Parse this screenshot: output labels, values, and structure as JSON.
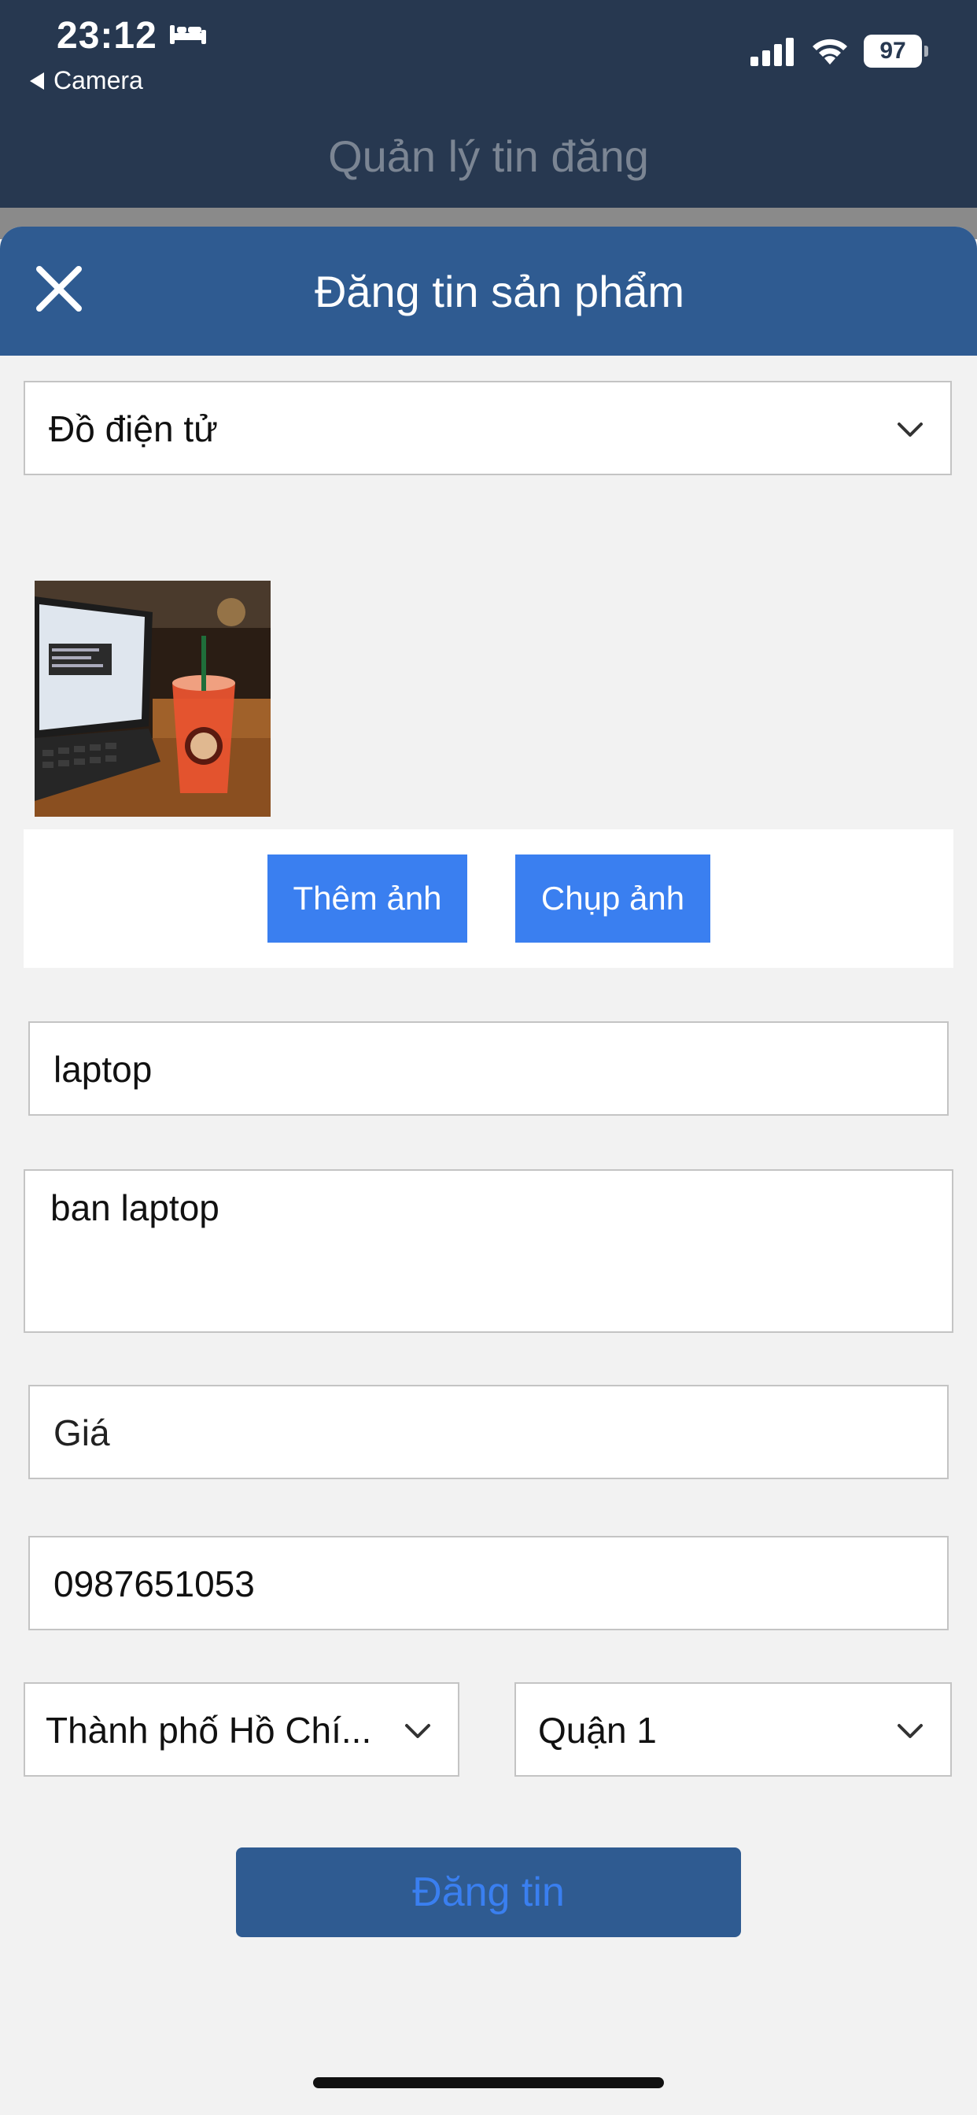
{
  "status_bar": {
    "time": "23:12",
    "back_app": "Camera",
    "battery": "97",
    "icons": [
      "bed-icon",
      "signal-icon",
      "wifi-icon",
      "battery-icon"
    ]
  },
  "background_screen": {
    "title": "Quản lý tin đăng"
  },
  "sheet": {
    "title": "Đăng tin sản phẩm",
    "close_icon": "close-icon"
  },
  "form": {
    "category": "Đồ điện tử",
    "photos_panel": {
      "add_photo_label": "Thêm ảnh",
      "take_photo_label": "Chụp ảnh"
    },
    "title_value": "laptop",
    "description_value": "ban laptop",
    "price_placeholder": "Giá",
    "phone_value": "0987651053",
    "city": "Thành phố Hồ Chí...",
    "district": "Quận 1",
    "submit_label": "Đăng tin"
  },
  "colors": {
    "app_header": "#273850",
    "sheet_header": "#2f5b91",
    "button_blue": "#3a7ff0",
    "background": "#f2f2f2"
  }
}
